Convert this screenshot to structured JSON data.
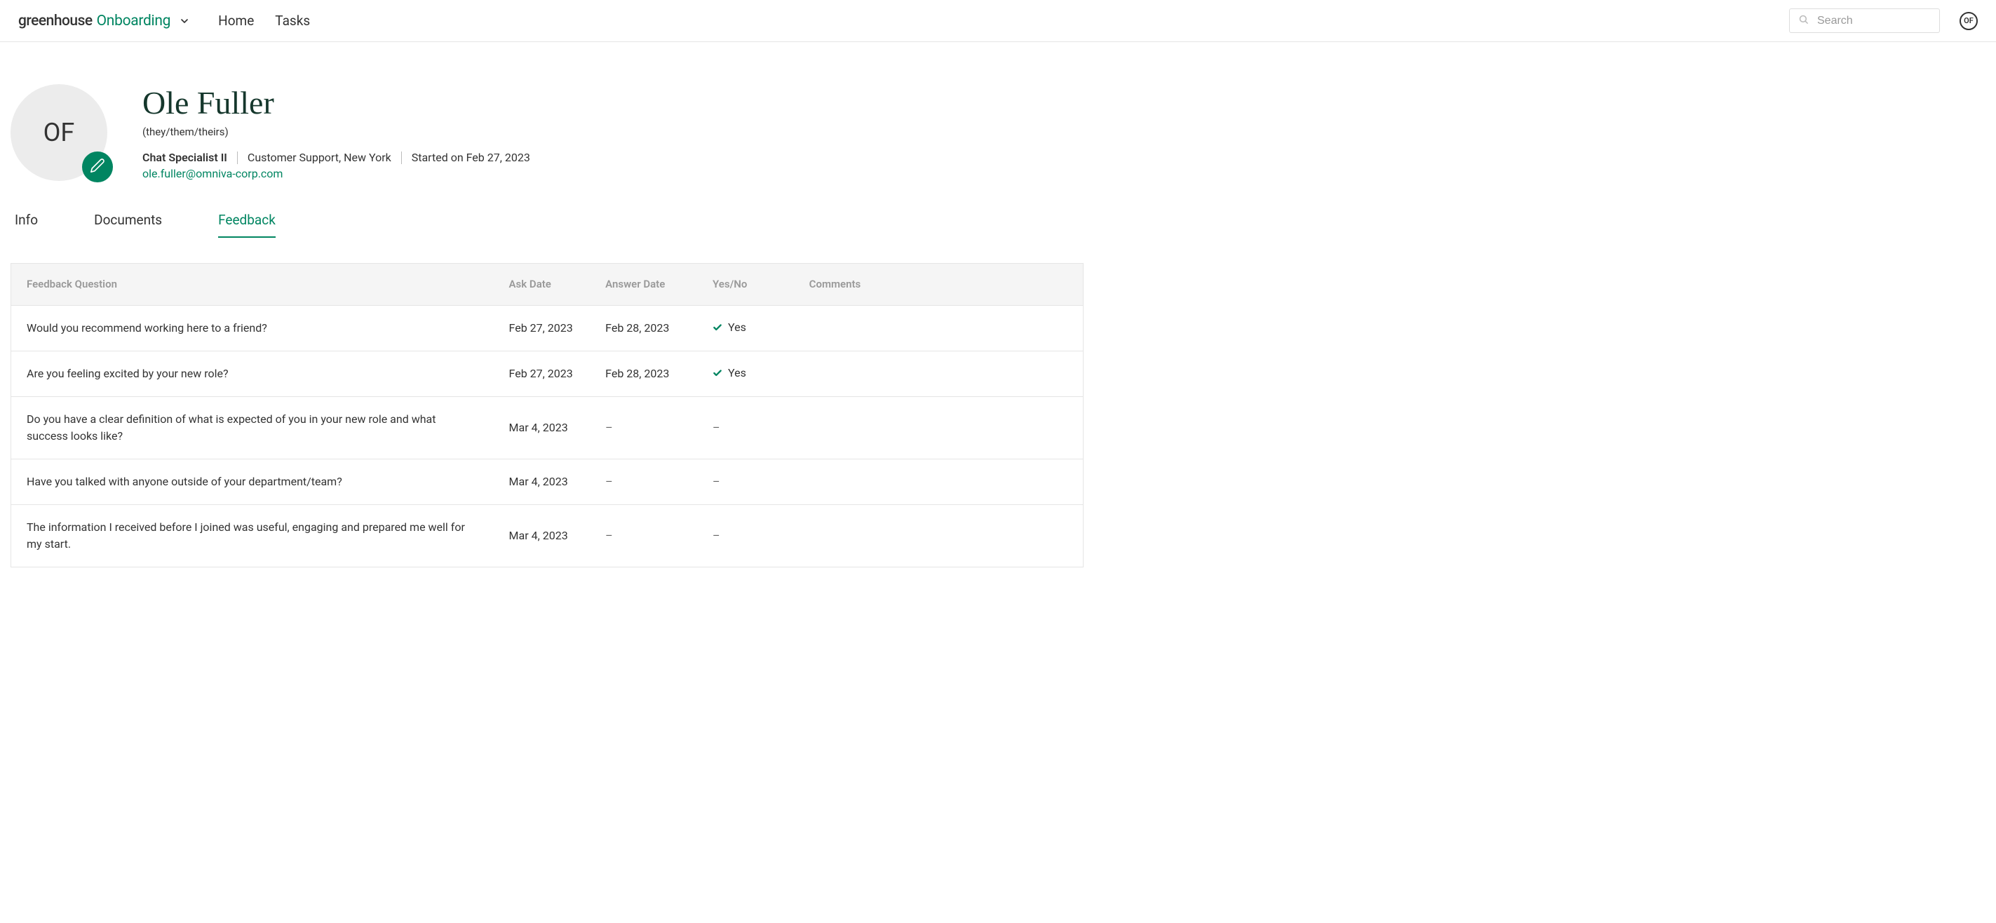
{
  "header": {
    "logo_part1": "greenhouse",
    "logo_part2": "Onboarding",
    "nav": [
      "Home",
      "Tasks"
    ],
    "search_placeholder": "Search",
    "user_initials": "OF"
  },
  "profile": {
    "avatar_initials": "OF",
    "name": "Ole Fuller",
    "pronouns": "(they/them/theirs)",
    "title": "Chat Specialist II",
    "dept_location": "Customer Support, New York",
    "start_text": "Started on Feb 27, 2023",
    "email": "ole.fuller@omniva-corp.com"
  },
  "tabs": [
    {
      "label": "Info",
      "active": false
    },
    {
      "label": "Documents",
      "active": false
    },
    {
      "label": "Feedback",
      "active": true
    }
  ],
  "table": {
    "headers": {
      "question": "Feedback Question",
      "ask": "Ask Date",
      "answer": "Answer Date",
      "yesno": "Yes/No",
      "comments": "Comments"
    },
    "rows": [
      {
        "question": "Would you recommend working here to a friend?",
        "ask": "Feb 27, 2023",
        "answer": "Feb 28, 2023",
        "yesno": "Yes",
        "has_check": true,
        "comments": ""
      },
      {
        "question": "Are you feeling excited by your new role?",
        "ask": "Feb 27, 2023",
        "answer": "Feb 28, 2023",
        "yesno": "Yes",
        "has_check": true,
        "comments": ""
      },
      {
        "question": "Do you have a clear definition of what is expected of you in your new role and what success looks like?",
        "ask": "Mar 4, 2023",
        "answer": "–",
        "yesno": "–",
        "has_check": false,
        "comments": ""
      },
      {
        "question": "Have you talked with anyone outside of your department/team?",
        "ask": "Mar 4, 2023",
        "answer": "–",
        "yesno": "–",
        "has_check": false,
        "comments": ""
      },
      {
        "question": "The information I received before I joined was useful, engaging and prepared me well for my start.",
        "ask": "Mar 4, 2023",
        "answer": "–",
        "yesno": "–",
        "has_check": false,
        "comments": ""
      }
    ]
  }
}
